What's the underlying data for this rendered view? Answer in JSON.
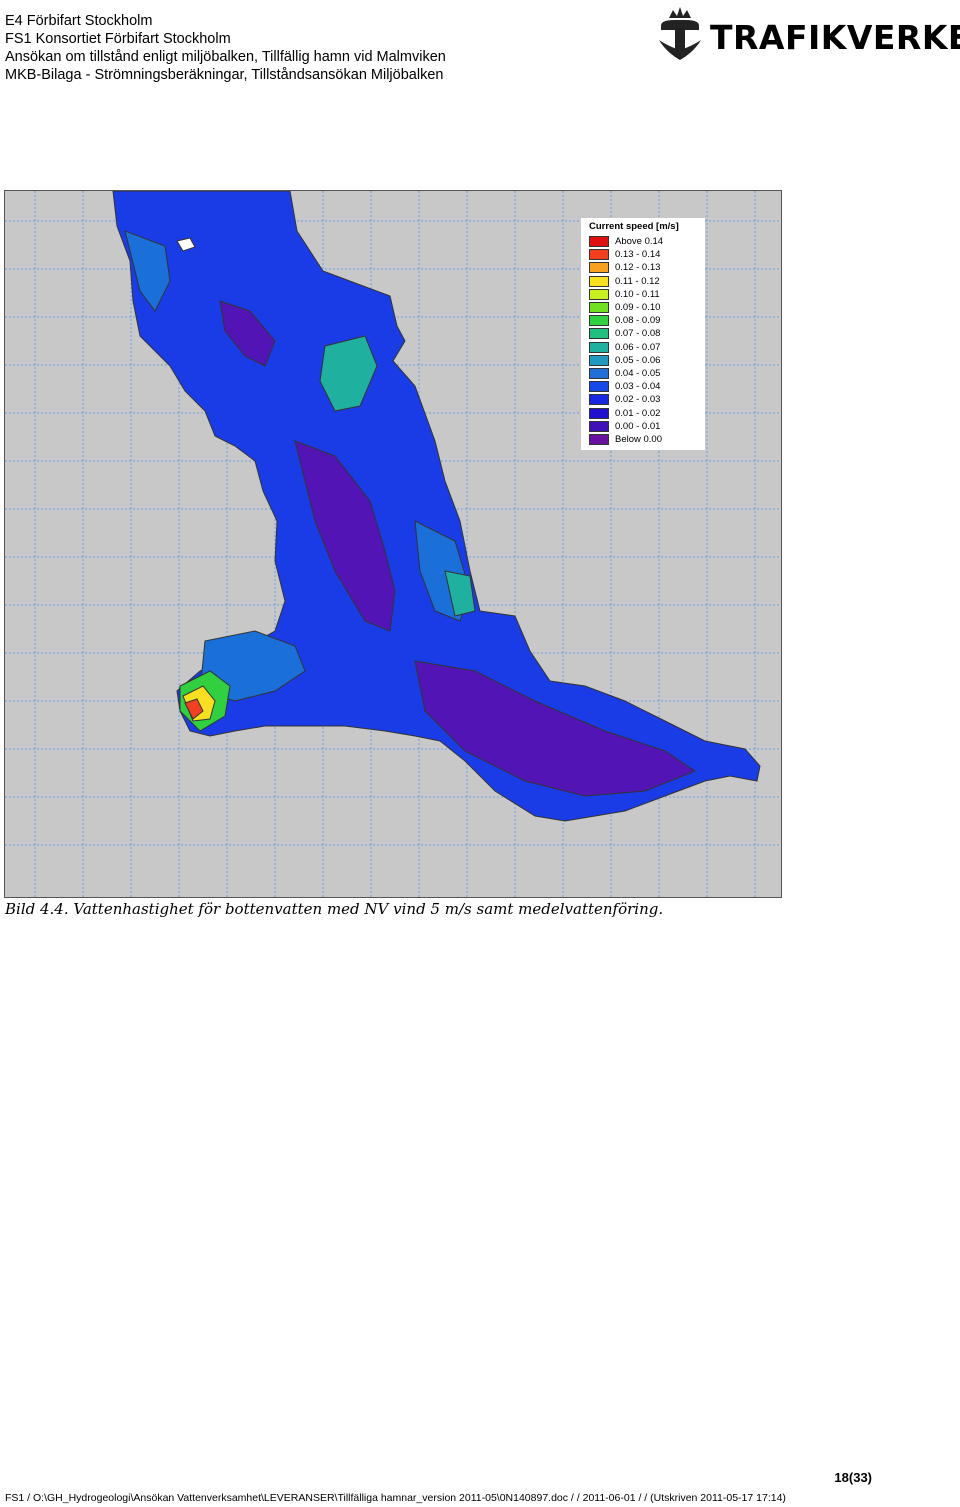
{
  "header": {
    "lines": [
      "E4 Förbifart Stockholm",
      "FS1 Konsortiet Förbifart Stockholm",
      "Ansökan om tillstånd enligt miljöbalken, Tillfällig hamn vid Malmviken",
      "MKB-Bilaga - Strömningsberäkningar, Tillståndsansökan Miljöbalken"
    ],
    "logo_text": "TRAFIKVERKET"
  },
  "figure": {
    "legend_title": "Current speed [m/s]",
    "legend_items": [
      {
        "label": "Above 0.14",
        "color": "#e01010"
      },
      {
        "label": "0.13 - 0.14",
        "color": "#f04020"
      },
      {
        "label": "0.12 - 0.13",
        "color": "#f8a020"
      },
      {
        "label": "0.11 - 0.12",
        "color": "#f8e020"
      },
      {
        "label": "0.10 - 0.11",
        "color": "#c8f020"
      },
      {
        "label": "0.09 - 0.10",
        "color": "#70e020"
      },
      {
        "label": "0.08 - 0.09",
        "color": "#30d040"
      },
      {
        "label": "0.07 - 0.08",
        "color": "#20c080"
      },
      {
        "label": "0.06 - 0.07",
        "color": "#20b0a0"
      },
      {
        "label": "0.05 - 0.06",
        "color": "#2098c0"
      },
      {
        "label": "0.04 - 0.05",
        "color": "#2070d8"
      },
      {
        "label": "0.03 - 0.04",
        "color": "#1848e8"
      },
      {
        "label": "0.02 - 0.03",
        "color": "#1828e0"
      },
      {
        "label": "0.01 - 0.02",
        "color": "#2010d0"
      },
      {
        "label": "0.00 - 0.01",
        "color": "#4010b8"
      },
      {
        "label": "Below 0.00",
        "color": "#6810a0"
      }
    ]
  },
  "caption": "Bild 4.4. Vattenhastighet för bottenvatten med NV vind 5 m/s samt medelvattenföring.",
  "page_number": "18(33)",
  "footer": "FS1 / O:\\GH_Hydrogeologi\\Ansökan Vattenverksamhet\\LEVERANSER\\Tillfälliga hamnar_version 2011-05\\0N140897.doc /  / 2011-06-01 /   / (Utskriven 2011-05-17 17:14)"
}
